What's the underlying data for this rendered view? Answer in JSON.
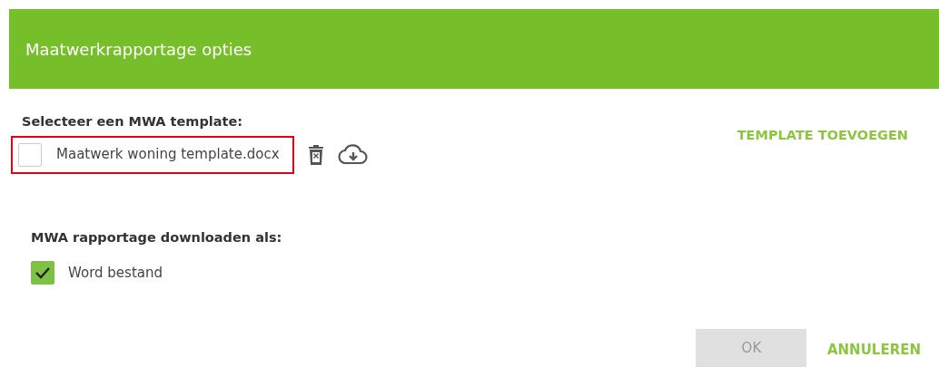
{
  "dialog": {
    "title": "Maatwerkrapportage opties"
  },
  "template_section": {
    "label": "Selecteer een MWA template:",
    "add_link": "TEMPLATE TOEVOEGEN",
    "templates": [
      {
        "name": "Maatwerk woning template.docx",
        "checked": false,
        "highlighted": true
      }
    ]
  },
  "download_section": {
    "label": "MWA rapportage downloaden als:",
    "options": [
      {
        "label": "Word bestand",
        "checked": true
      }
    ]
  },
  "buttons": [
    {
      "label": "OK",
      "kind": "filled",
      "disabled": true
    },
    {
      "label": "ANNULEREN",
      "kind": "text",
      "disabled": false
    }
  ]
}
